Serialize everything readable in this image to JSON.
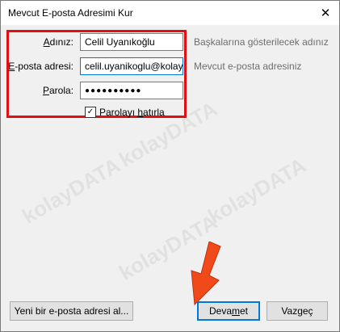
{
  "window": {
    "title": "Mevcut E-posta Adresimi Kur",
    "close_glyph": "✕"
  },
  "form": {
    "name_label_a": "A",
    "name_label_b": "dınız:",
    "name_value": "Celil Uyanıkoğlu",
    "name_hint": "Başkalarına gösterilecek adınız",
    "email_label_a": "E",
    "email_label_b": "-posta adresi:",
    "email_value": "celil.uyanikoglu@kolay",
    "email_hint": "Mevcut e-posta adresiniz",
    "password_label_a": "P",
    "password_label_b": "arola:",
    "password_value": "●●●●●●●●●●",
    "remember_label_a": "Parolayı ",
    "remember_label_b": "h",
    "remember_label_c": "atırla",
    "remember_checked_glyph": "✓"
  },
  "buttons": {
    "new_address": "Yeni bir e-posta adresi al...",
    "continue_a": "Deva",
    "continue_b": "m",
    "continue_c": " et",
    "cancel": "Vazgeç"
  },
  "watermark_text": "kolayDATA",
  "colors": {
    "highlight_box": "#e01010",
    "arrow": "#f04a1a",
    "focus_border": "#0078d7"
  }
}
